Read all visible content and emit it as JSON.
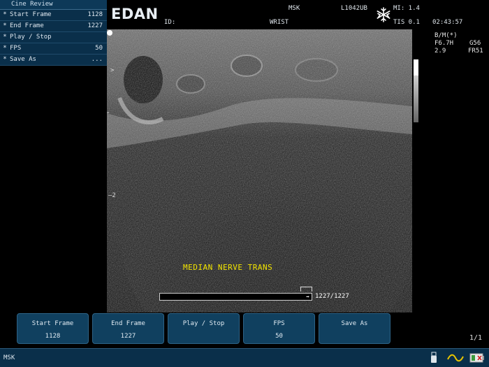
{
  "cine_menu": {
    "title": "Cine Review",
    "items": [
      {
        "marker": "*",
        "label": "Start Frame",
        "value": "1128"
      },
      {
        "marker": "*",
        "label": "End Frame",
        "value": "1227"
      },
      {
        "marker": "*",
        "label": "Play / Stop",
        "value": ""
      },
      {
        "marker": "*",
        "label": "FPS",
        "value": "50"
      },
      {
        "marker": "*",
        "label": "Save As",
        "value": "..."
      }
    ]
  },
  "header": {
    "logo": "EDAN",
    "id_label": "ID:",
    "exam": "MSK",
    "preset": "WRIST",
    "probe": "L1042UB",
    "mi": "MI: 1.4",
    "tis": "TIS 0.1",
    "time": "02:43:57",
    "freeze_icon": "snowflake-icon"
  },
  "params": {
    "mode": "B/M(*)",
    "freq": "F6.7H",
    "gain": "G56",
    "depth": "2.9",
    "frame_rate": "FR51"
  },
  "image": {
    "annotation": "MEDIAN NERVE TRANS",
    "depth_marker": "2",
    "focus_marker": ">"
  },
  "cine": {
    "count": "1227/1227",
    "position": 1.0
  },
  "softkeys": [
    {
      "label": "Start Frame",
      "value": "1128"
    },
    {
      "label": "End Frame",
      "value": "1227"
    },
    {
      "label": "Play / Stop",
      "value": ""
    },
    {
      "label": "FPS",
      "value": "50"
    },
    {
      "label": "Save As",
      "value": ""
    }
  ],
  "page_indicator": "1/1",
  "status_bar": {
    "text": "MSK",
    "icons": [
      "usb-icon",
      "wave-icon",
      "battery-icon"
    ]
  },
  "colors": {
    "panel": "#0a2f4a",
    "softkey": "#10405f",
    "annotation": "#f2e400"
  }
}
